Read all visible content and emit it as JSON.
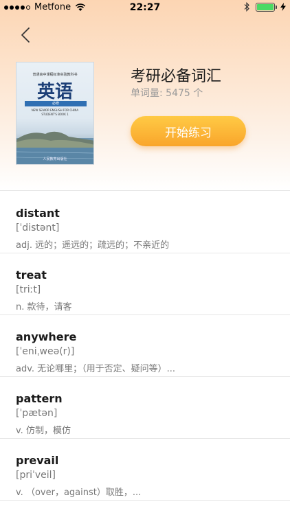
{
  "status_bar": {
    "carrier": "Metfone",
    "time": "22:27"
  },
  "book": {
    "title": "考研必备词汇",
    "count": "单词量: 5475 个",
    "cover": {
      "top_text": "普通高中课程标准实验教科书",
      "title": "英语",
      "band": "必修",
      "sub1": "NEW SENIOR ENGLISH FOR CHINA",
      "sub2": "STUDENT'S BOOK 1",
      "publisher": "人民教育出版社"
    }
  },
  "start_button": {
    "label": "开始练习"
  },
  "words": [
    {
      "word": "distant",
      "phonetic": "[ˈdistənt]",
      "meaning": "adj. 远的；遥远的；疏远的；不亲近的"
    },
    {
      "word": "treat",
      "phonetic": "[triːt]",
      "meaning": "n. 款待，请客"
    },
    {
      "word": "anywhere",
      "phonetic": "[ˈeniˌweə(r)]",
      "meaning": "adv. 无论哪里；（用于否定、疑问等）..."
    },
    {
      "word": "pattern",
      "phonetic": "[ˈpætən]",
      "meaning": "v. 仿制，模仿"
    },
    {
      "word": "prevail",
      "phonetic": "[priˈveil]",
      "meaning": "v. （over，against）取胜，..."
    }
  ],
  "colors": {
    "accent": "#f9a52b",
    "header_gradient_top": "#fcd5b3",
    "battery": "#4cd964"
  }
}
